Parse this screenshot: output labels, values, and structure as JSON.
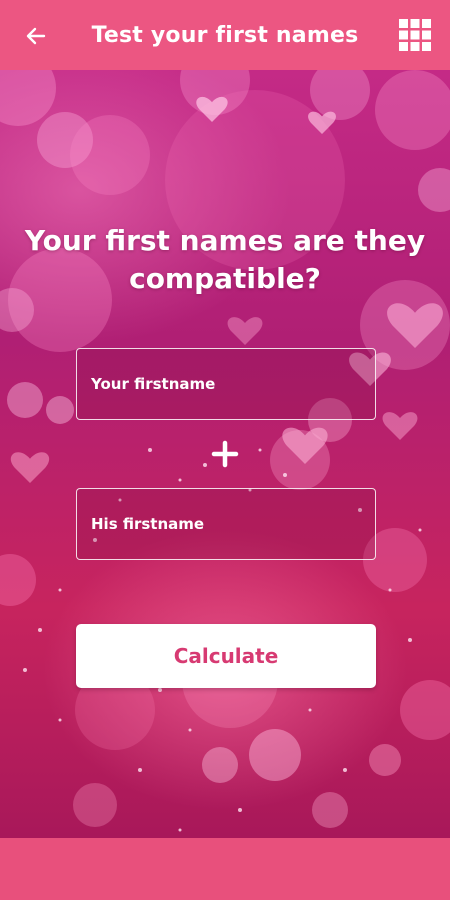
{
  "app_bar": {
    "title": "Test your first names",
    "back_icon": "arrow-left-icon",
    "menu_icon": "grid-icon",
    "color": "#ec5682"
  },
  "main": {
    "headline_line1": "Your first names are they",
    "headline_line2": "compatible?",
    "first_name_placeholder": "Your firstname",
    "second_name_placeholder": "His firstname",
    "first_name_value": "",
    "second_name_value": "",
    "plus_icon": "plus-icon",
    "calculate_label": "Calculate"
  },
  "colors": {
    "accent": "#ec5682",
    "button_text": "#d73a72",
    "background": "#c42a86"
  }
}
